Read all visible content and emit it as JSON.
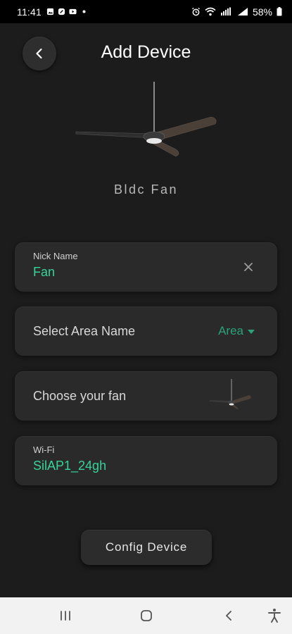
{
  "status_bar": {
    "time": "11:41",
    "battery": "58%"
  },
  "header": {
    "title": "Add Device",
    "back_icon": "chevron-left-icon"
  },
  "device": {
    "type_label": "Bldc Fan",
    "image": "ceiling-fan-image"
  },
  "form": {
    "nick_name": {
      "label": "Nick Name",
      "value": "Fan",
      "clear_icon": "close-icon"
    },
    "area": {
      "label": "Select Area Name",
      "dropdown_value": "Area",
      "dropdown_icon": "caret-down-icon"
    },
    "fan_choice": {
      "label": "Choose your fan",
      "thumb": "ceiling-fan-thumbnail"
    },
    "wifi": {
      "label": "Wi-Fi",
      "value": "SilAP1_24gh"
    }
  },
  "actions": {
    "config_label": "Config Device"
  },
  "colors": {
    "background": "#1c1c1c",
    "card": "#2a2a2a",
    "accent_green": "#36d49a",
    "dropdown_green": "#2aa37a",
    "nav_bar": "#f2f2f2"
  },
  "nav_bar": {
    "recent_icon": "recent-apps-icon",
    "home_icon": "home-icon",
    "back_icon": "back-icon",
    "accessibility_icon": "accessibility-icon"
  }
}
